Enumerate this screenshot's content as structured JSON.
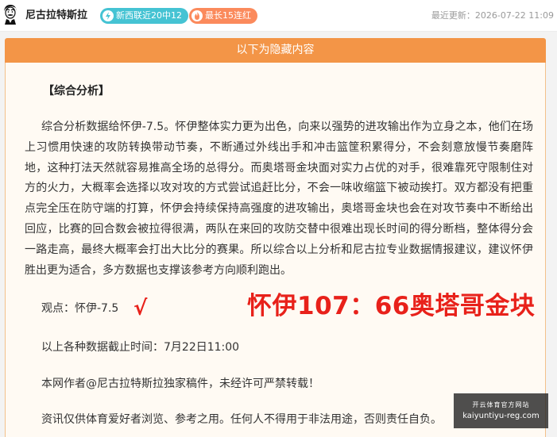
{
  "header": {
    "author_name": "尼古拉特斯拉",
    "badge_recent": "新西联近20中12",
    "badge_streak": "最长15连红",
    "last_updated": "最近更新：2026-07-22 11:09"
  },
  "hidden_bar": {
    "label": "以下为隐藏内容"
  },
  "article": {
    "section_title": "【综合分析】",
    "analysis": "综合分析数据给怀伊-7.5。怀伊整体实力更为出色，向来以强势的进攻输出作为立身之本，他们在场上习惯用快速的攻防转换带动节奏，不断通过外线出手和冲击篮筐积累得分，不会刻意放慢节奏磨阵地，这种打法天然就容易推高全场的总得分。而奥塔哥金块面对实力占优的对手，很难靠死守限制住对方的火力，大概率会选择以攻对攻的方式尝试追赶比分，不会一味收缩篮下被动挨打。双方都没有把重点完全压在防守端的打算，怀伊会持续保持高强度的进攻输出，奥塔哥金块也会在对攻节奏中不断给出回应，比赛的回合数会被拉得很满，两队在来回的攻防交替中很难出现长时间的得分断档，整体得分会一路走高，最终大概率会打出大比分的赛果。所以综合以上分析和尼古拉专业数据情报建议，建议怀伊胜出更为适合，多方数据也支撑该参考方向顺利跑出。",
    "pick": "观点：怀伊-7.5",
    "check_mark": "√",
    "result": "怀伊107：66奥塔哥金块",
    "cutoff": "以上各种数据截止时间：7月22日11:00",
    "copyright": "本网作者@尼古拉特斯拉独家稿件，未经许可严禁转载！",
    "disclaimer": "资讯仅供体育爱好者浏览、参考之用。任何人不得用于非法用途，否则责任自负。"
  },
  "watermark": {
    "logo_text": "开云体育官方网站",
    "url": "kaiyuntiyu-reg.com"
  },
  "colors": {
    "accent_orange": "#f39547",
    "badge_teal": "#45c3d3",
    "badge_orange": "#fb8a5c",
    "result_red": "#e8211a"
  },
  "icons": [
    "avatar",
    "lightning-icon",
    "flame-icon",
    "check-icon"
  ]
}
